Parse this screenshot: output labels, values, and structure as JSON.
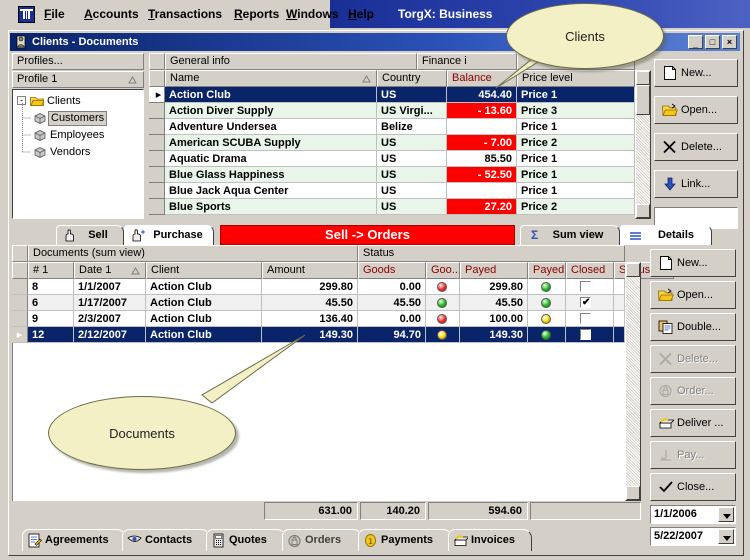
{
  "menu": {
    "app_icon": "pillar-icon",
    "items": [
      {
        "label": "File",
        "accel": "F"
      },
      {
        "label": "Accounts",
        "accel": "A"
      },
      {
        "label": "Transactions",
        "accel": "T"
      },
      {
        "label": "Reports",
        "accel": "R"
      },
      {
        "label": "Windows",
        "accel": "W"
      },
      {
        "label": "Help",
        "accel": "H"
      }
    ],
    "app_title": "TorgX: Business"
  },
  "window": {
    "title": "Clients - Documents",
    "icon": "clients-window-icon",
    "minimize": "_",
    "maximize": "□",
    "close": "×"
  },
  "profiles": {
    "header": "Profiles...",
    "subheader": "Profile 1",
    "sort_icon": "sort-ascending-icon",
    "tree": [
      {
        "label": "Clients",
        "icon": "folder-open-icon",
        "level": 0,
        "expander": "-",
        "selected": false
      },
      {
        "label": "Customers",
        "icon": "node-icon",
        "level": 1,
        "expander": "",
        "selected": true
      },
      {
        "label": "Employees",
        "icon": "node-icon",
        "level": 1,
        "expander": "",
        "selected": false
      },
      {
        "label": "Vendors",
        "icon": "node-icon",
        "level": 1,
        "expander": "",
        "selected": false
      }
    ]
  },
  "clients_grid": {
    "group_headers": [
      {
        "label": "General info"
      },
      {
        "label": "Finance i"
      }
    ],
    "columns": [
      {
        "label": "Name",
        "sort": "▵"
      },
      {
        "label": "Country",
        "sort": ""
      },
      {
        "label": "Balance",
        "sort": "",
        "red": true
      },
      {
        "label": "Price level",
        "sort": ""
      }
    ],
    "rows": [
      {
        "name": "Action Club",
        "country": "US",
        "balance": "454.40",
        "negative": false,
        "price": "Price 1",
        "selected": true
      },
      {
        "name": "Action Diver Supply",
        "country": "US Virgi...",
        "balance": "-  13.60",
        "negative": true,
        "price": "Price 3",
        "selected": false
      },
      {
        "name": "Adventure Undersea",
        "country": "Belize",
        "balance": "",
        "negative": false,
        "price": "Price 1",
        "selected": false
      },
      {
        "name": "American SCUBA Supply",
        "country": "US",
        "balance": "-   7.00",
        "negative": true,
        "price": "Price 2",
        "selected": false
      },
      {
        "name": "Aquatic Drama",
        "country": "US",
        "balance": "85.50",
        "negative": false,
        "price": "Price 1",
        "selected": false
      },
      {
        "name": "Blue Glass Happiness",
        "country": "US",
        "balance": "-  52.50",
        "negative": true,
        "price": "Price 1",
        "selected": false
      },
      {
        "name": "Blue Jack Aqua Center",
        "country": "US",
        "balance": "",
        "negative": false,
        "price": "Price 1",
        "selected": false
      },
      {
        "name": "Blue Sports",
        "country": "US",
        "balance": "27.20",
        "negative": true,
        "price": "Price 2",
        "selected": false
      }
    ]
  },
  "clients_buttons": [
    {
      "label": "New...",
      "icon": "new-document-icon",
      "disabled": false
    },
    {
      "label": "Open...",
      "icon": "open-folder-icon",
      "disabled": false
    },
    {
      "label": "Delete...",
      "icon": "delete-x-icon",
      "disabled": false
    },
    {
      "label": "Link...",
      "icon": "link-down-arrow-icon",
      "disabled": false
    }
  ],
  "doc_tabs": {
    "left": [
      {
        "label": "Sell",
        "icon": "hand-sell-icon",
        "active": false
      },
      {
        "label": "Purchase",
        "icon": "hand-purchase-icon",
        "active": true
      }
    ],
    "banner": "Sell  -> Orders",
    "banner_color": "#ff0000",
    "right": [
      {
        "label": "Sum view",
        "icon": "sigma-icon",
        "active": false
      },
      {
        "label": "Details",
        "icon": "list-lines-icon",
        "active": true
      }
    ]
  },
  "documents_grid": {
    "group_headers": [
      {
        "label": "Documents (sum view)"
      },
      {
        "label": "Status"
      }
    ],
    "columns": [
      {
        "label": "# 1",
        "red": false,
        "sort": ""
      },
      {
        "label": "Date 1",
        "red": false,
        "sort": "▵"
      },
      {
        "label": "Client",
        "red": false,
        "sort": ""
      },
      {
        "label": "Amount",
        "red": false,
        "sort": ""
      },
      {
        "label": "Goods",
        "red": true,
        "sort": ""
      },
      {
        "label": "Goo...",
        "red": true,
        "sort": ""
      },
      {
        "label": "Payed",
        "red": true,
        "sort": ""
      },
      {
        "label": "Payed",
        "red": true,
        "sort": ""
      },
      {
        "label": "Closed",
        "red": true,
        "sort": ""
      },
      {
        "label": "Status",
        "red": true,
        "sort": ""
      }
    ],
    "rows": [
      {
        "num": "8",
        "date": "1/1/2007",
        "client": "Action Club",
        "amount": "299.80",
        "goods": "0.00",
        "goods_light": "red",
        "payed": "299.80",
        "payed_light": "green",
        "closed": false,
        "status": "",
        "selected": false
      },
      {
        "num": "6",
        "date": "1/17/2007",
        "client": "Action Club",
        "amount": "45.50",
        "goods": "45.50",
        "goods_light": "green",
        "payed": "45.50",
        "payed_light": "green",
        "closed": true,
        "status": "",
        "selected": false
      },
      {
        "num": "9",
        "date": "2/3/2007",
        "client": "Action Club",
        "amount": "136.40",
        "goods": "0.00",
        "goods_light": "red",
        "payed": "100.00",
        "payed_light": "yellow",
        "closed": false,
        "status": "",
        "selected": false
      },
      {
        "num": "12",
        "date": "2/12/2007",
        "client": "Action Club",
        "amount": "149.30",
        "goods": "94.70",
        "goods_light": "yellow",
        "payed": "149.30",
        "payed_light": "green",
        "closed": false,
        "status": "",
        "selected": true
      }
    ],
    "footer_sums": [
      "631.00",
      "140.20",
      "594.60"
    ]
  },
  "documents_buttons": [
    {
      "label": "New...",
      "icon": "new-document-icon",
      "disabled": false
    },
    {
      "label": "Open...",
      "icon": "open-folder-icon",
      "disabled": false
    },
    {
      "label": "Double...",
      "icon": "copy-icon",
      "disabled": false
    },
    {
      "label": "Delete...",
      "icon": "delete-x-icon",
      "disabled": true
    },
    {
      "label": "Order...",
      "icon": "lock-icon",
      "disabled": true
    },
    {
      "label": "Deliver ...",
      "icon": "deliver-box-icon",
      "disabled": false
    },
    {
      "label": "Pay...",
      "icon": "pay-icon",
      "disabled": true
    },
    {
      "label": "Close...",
      "icon": "check-icon",
      "disabled": false
    }
  ],
  "date_filters": [
    {
      "value": "1/1/2006",
      "name": "date-from"
    },
    {
      "value": "5/22/2007",
      "name": "date-to"
    }
  ],
  "bottom_tabs": [
    {
      "label": "Agreements",
      "icon": "agreements-icon",
      "active": false
    },
    {
      "label": "Contacts",
      "icon": "contacts-icon",
      "active": false
    },
    {
      "label": "Quotes",
      "icon": "quotes-icon",
      "active": false
    },
    {
      "label": "Orders",
      "icon": "orders-lock-icon",
      "active": true
    },
    {
      "label": "Payments",
      "icon": "payments-coin-icon",
      "active": false
    },
    {
      "label": "Invoices",
      "icon": "invoices-icon",
      "active": false
    }
  ],
  "callouts": [
    {
      "text": "Clients",
      "name": "callout-clients"
    },
    {
      "text": "Documents",
      "name": "callout-documents"
    }
  ],
  "colors": {
    "accent_blue": "#0a246a",
    "negative_red": "#ff0000",
    "banner_red": "#ff0000",
    "alt_row_green": "#e8f5e8",
    "callout_yellow": "#f2f0c4"
  }
}
